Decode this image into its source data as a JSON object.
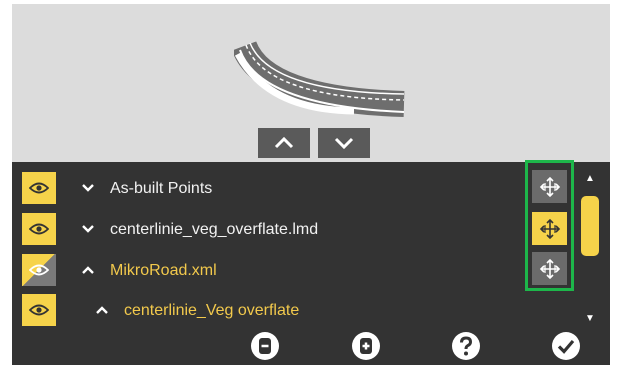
{
  "viewer": {
    "nav_up_icon": "chevron-up-icon",
    "nav_down_icon": "chevron-down-icon"
  },
  "layers": [
    {
      "label": "As-built Points",
      "expanded": false,
      "visibility": "visible",
      "highlighted": false
    },
    {
      "label": "centerlinie_veg_overflate.lmd",
      "expanded": false,
      "visibility": "visible",
      "highlighted": false
    },
    {
      "label": "MikroRoad.xml",
      "expanded": true,
      "visibility": "partial",
      "highlighted": true
    },
    {
      "label": "centerlinie_Veg overflate",
      "expanded": true,
      "visibility": "visible",
      "highlighted": true
    }
  ],
  "move_buttons": [
    {
      "icon": "move-arrows-icon",
      "active": false
    },
    {
      "icon": "move-arrows-icon",
      "active": true
    },
    {
      "icon": "move-arrows-icon",
      "active": false
    }
  ],
  "toolbar": [
    {
      "icon": "collapse-all-icon"
    },
    {
      "icon": "expand-all-icon"
    },
    {
      "icon": "help-icon"
    },
    {
      "icon": "confirm-check-icon"
    }
  ],
  "colors": {
    "accent": "#f6d34a",
    "panel": "#333333",
    "viewer_bg": "#dcdcdc",
    "highlight_border": "#1db64a",
    "highlight_text": "#f2c94c"
  }
}
